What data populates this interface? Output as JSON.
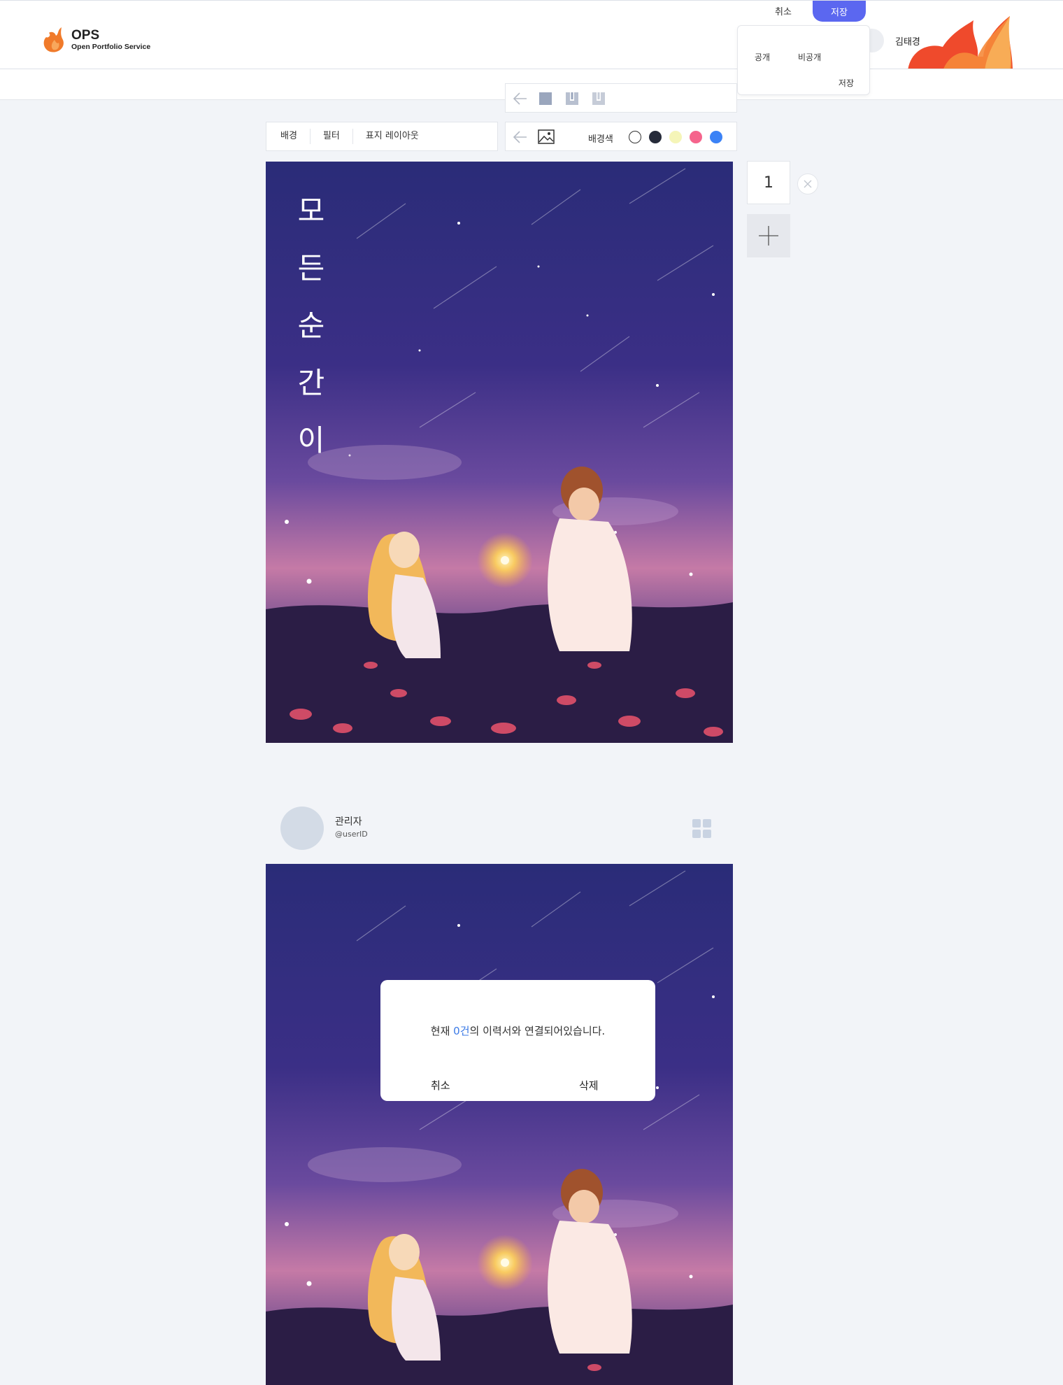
{
  "header": {
    "logo_title": "OPS",
    "logo_subtitle": "Open Portfolio Service",
    "user_name": "김태경",
    "cancel_label": "취소",
    "save_label": "저장",
    "accent_color": "#5b67f0"
  },
  "visibility_menu": {
    "public_label": "공개",
    "private_label": "비공개",
    "save_label": "저장"
  },
  "editor_tabs": [
    "배경",
    "필터",
    "표지 레이아웃"
  ],
  "layout_toolbar": {
    "icons": [
      "back-arrow-icon",
      "layout-full-icon",
      "layout-split-icon",
      "layout-bottom-icon"
    ]
  },
  "background_toolbar": {
    "label": "배경색",
    "icons": [
      "back-arrow-icon",
      "image-icon"
    ],
    "swatches": [
      "#ffffff",
      "#262b3a",
      "#f5f5b8",
      "#f5648c",
      "#3b82f6"
    ]
  },
  "cover": {
    "title_chars": [
      "모",
      "든",
      "순",
      "간",
      "이"
    ]
  },
  "pages": {
    "current": "1"
  },
  "profile": {
    "name": "관리자",
    "user_id": "@userID"
  },
  "modal": {
    "message_prefix": "현재 ",
    "count": "0건",
    "message_suffix": "의 이력서와 연결되어있습니다.",
    "cancel_label": "취소",
    "delete_label": "삭제"
  }
}
